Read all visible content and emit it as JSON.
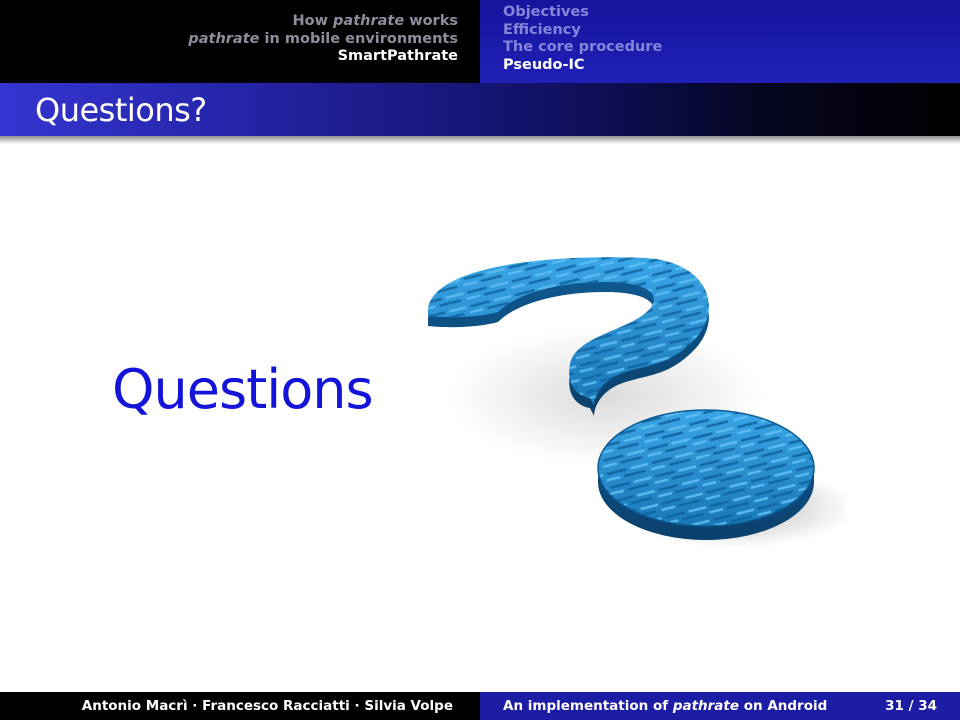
{
  "nav": {
    "sections": [
      {
        "pre": "How ",
        "em": "pathrate",
        "post": " works"
      },
      {
        "pre": "",
        "em": "pathrate",
        "post": " in mobile environments"
      },
      {
        "pre": "SmartPathrate",
        "em": "",
        "post": ""
      }
    ],
    "subsections": [
      "Objectives",
      "Efficiency",
      "The core procedure",
      "Pseudo-IC"
    ]
  },
  "frame": {
    "title": "Questions?",
    "big_text": "Questions"
  },
  "image": {
    "icon": "question-mark-word-cloud",
    "color": "#1f87c8",
    "words": [
      "who",
      "how",
      "which",
      "why",
      "what",
      "where",
      "when",
      "whom"
    ]
  },
  "footer": {
    "authors": "Antonio Macrì · Francesco Racciatti · Silvia Volpe",
    "title_pre": "An implementation of ",
    "title_em": "pathrate",
    "title_post": " on Android",
    "page": "31 / 34"
  },
  "colors": {
    "header_left": "#000000",
    "header_right": "#1a1aab",
    "accent_text": "#1414d8",
    "footer_right": "#1c1ca4"
  }
}
